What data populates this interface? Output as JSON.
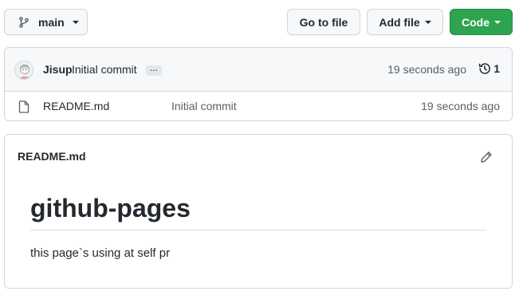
{
  "toolbar": {
    "branch_label": "main",
    "goto_file_label": "Go to file",
    "add_file_label": "Add file",
    "code_label": "Code"
  },
  "latest_commit": {
    "author": "Jisup",
    "message": "Initial commit",
    "ellipsis": "…",
    "time": "19 seconds ago",
    "history_count": "1"
  },
  "files": [
    {
      "name": "README.md",
      "commit_message": "Initial commit",
      "time": "19 seconds ago",
      "icon": "file-icon"
    }
  ],
  "readme": {
    "filename": "README.md",
    "heading": "github-pages",
    "paragraph": "this page`s using at self pr"
  },
  "colors": {
    "code_button": "#2da44e",
    "border": "#d0d7de",
    "header_bg": "#f6f8fa",
    "muted_text": "#57606a"
  }
}
